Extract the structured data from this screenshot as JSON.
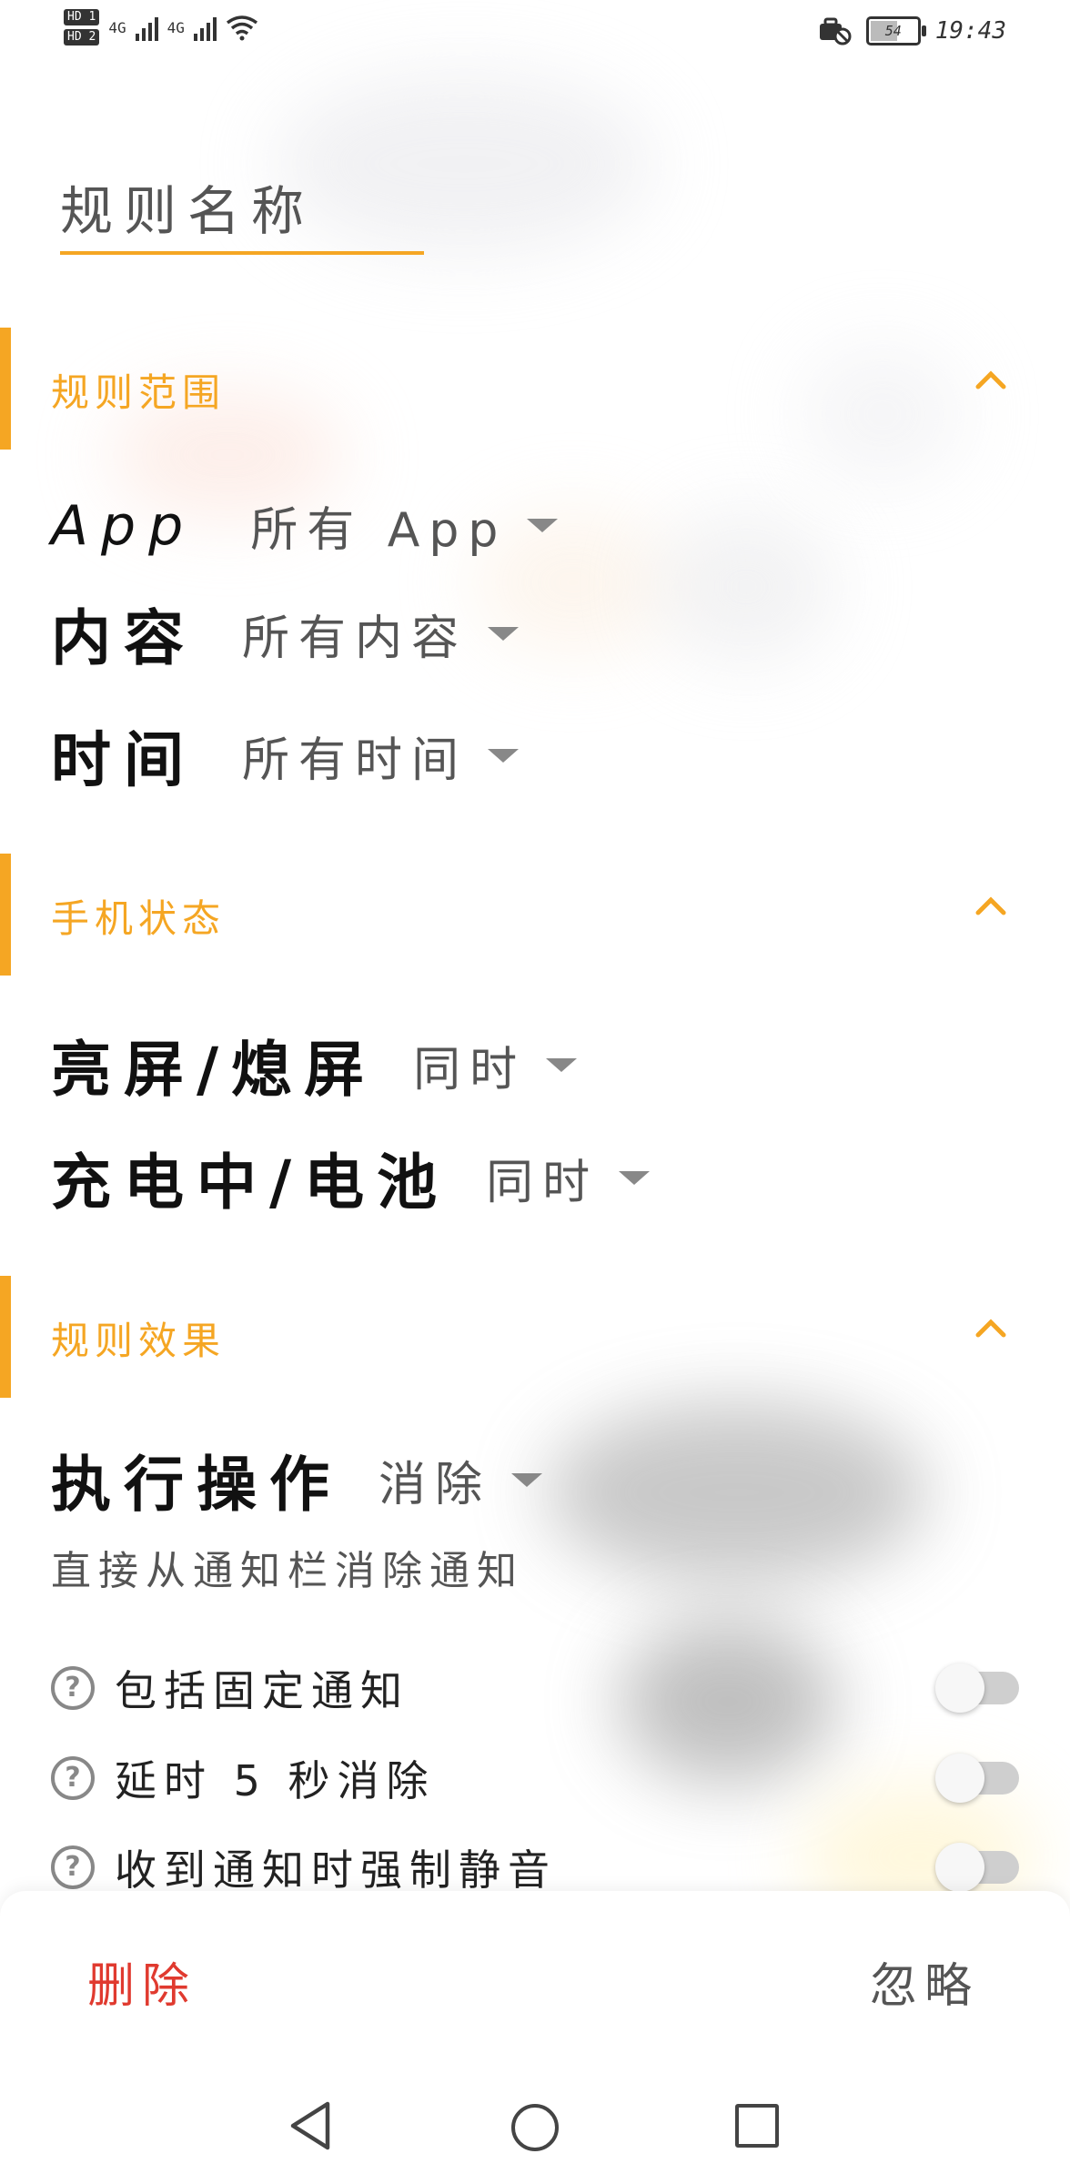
{
  "status_bar": {
    "sim1": "HD 1",
    "sim2": "HD 2",
    "net1": "4G",
    "net2": "4G",
    "battery": "54",
    "time": "19:43"
  },
  "rule_name": {
    "placeholder": "规则名称"
  },
  "sections": {
    "scope": {
      "title": "规则范围",
      "app": {
        "label": "App",
        "value": "所有 App"
      },
      "content": {
        "label": "内容",
        "value": "所有内容"
      },
      "time": {
        "label": "时间",
        "value": "所有时间"
      }
    },
    "phone_state": {
      "title": "手机状态",
      "screen": {
        "label": "亮屏/熄屏",
        "value": "同时"
      },
      "charging": {
        "label": "充电中/电池",
        "value": "同时"
      }
    },
    "effect": {
      "title": "规则效果",
      "action": {
        "label": "执行操作",
        "value": "消除"
      },
      "action_desc": "直接从通知栏消除通知",
      "options": [
        {
          "label": "包括固定通知",
          "enabled": false
        },
        {
          "label": "延时 5 秒消除",
          "enabled": false
        },
        {
          "label": "收到通知时强制静音",
          "enabled": false
        }
      ]
    }
  },
  "footer": {
    "delete": "删除",
    "ignore": "忽略"
  },
  "colors": {
    "accent": "#f5a623",
    "delete": "#e03a2f"
  }
}
